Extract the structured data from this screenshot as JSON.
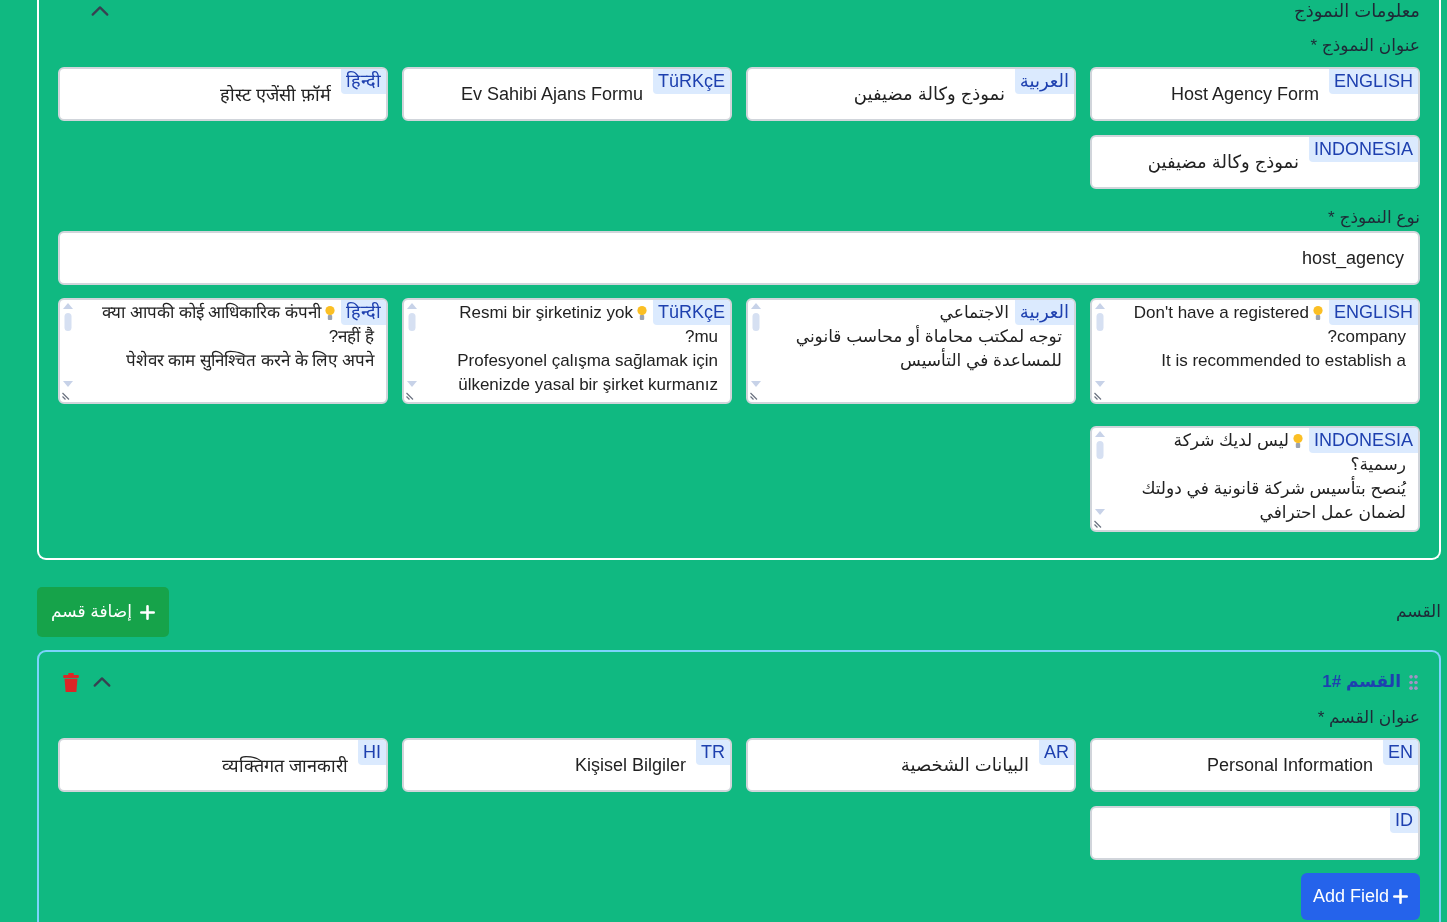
{
  "form_info": {
    "heading": "معلومات النموذج",
    "expanded": true,
    "title_label": "عنوان النموذج *",
    "titles": [
      {
        "lang": "ENGLISH",
        "value": "Host Agency Form"
      },
      {
        "lang": "العربية",
        "value": "نموذج وكالة مضيفين"
      },
      {
        "lang": "TüRKçE",
        "value": "Ev Sahibi Ajans Formu"
      },
      {
        "lang": "हिन्दी",
        "value": "होस्ट एजेंसी फ़ॉर्म"
      },
      {
        "lang": "INDONESIA",
        "value": "نموذج وكالة مضيفين"
      }
    ],
    "type_label": "نوع النموذج *",
    "type_value": "host_agency",
    "descriptions": [
      {
        "lang": "ENGLISH",
        "tip_icon": true,
        "text": "Don't have a registered company?\nIt is recommended to establish a"
      },
      {
        "lang": "العربية",
        "tip_icon": false,
        "text": "الاجتماعي\nتوجه لمكتب محاماة أو محاسب قانوني\nللمساعدة في التأسيس"
      },
      {
        "lang": "TüRKçE",
        "tip_icon": true,
        "text": "Resmi bir şirketiniz yok mu?\nProfesyonel çalışma sağlamak için ülkenizde yasal bir şirket kurmanız"
      },
      {
        "lang": "हिन्दी",
        "tip_icon": true,
        "text": "क्या आपकी कोई आधिकारिक कंपनी नहीं है?\nपेशेवर काम सुनिश्चित करने के लिए अपने"
      },
      {
        "lang": "INDONESIA",
        "tip_icon": true,
        "text": "ليس لديك شركة رسمية؟\nيُنصح بتأسيس شركة قانونية في دولتك\nلضمان عمل احترافي"
      }
    ]
  },
  "sections_label": "القسم",
  "add_section_button": "إضافة قسم",
  "sections": [
    {
      "title": "القسم #1",
      "expanded": true,
      "title_label": "عنوان القسم *",
      "titles": [
        {
          "lang": "EN",
          "value": "Personal Information"
        },
        {
          "lang": "AR",
          "value": "البيانات الشخصية"
        },
        {
          "lang": "TR",
          "value": "Kişisel Bilgiler"
        },
        {
          "lang": "HI",
          "value": "व्यक्तिगत जानकारी"
        },
        {
          "lang": "ID"
        }
      ],
      "add_field_button": "Add Field"
    }
  ]
}
